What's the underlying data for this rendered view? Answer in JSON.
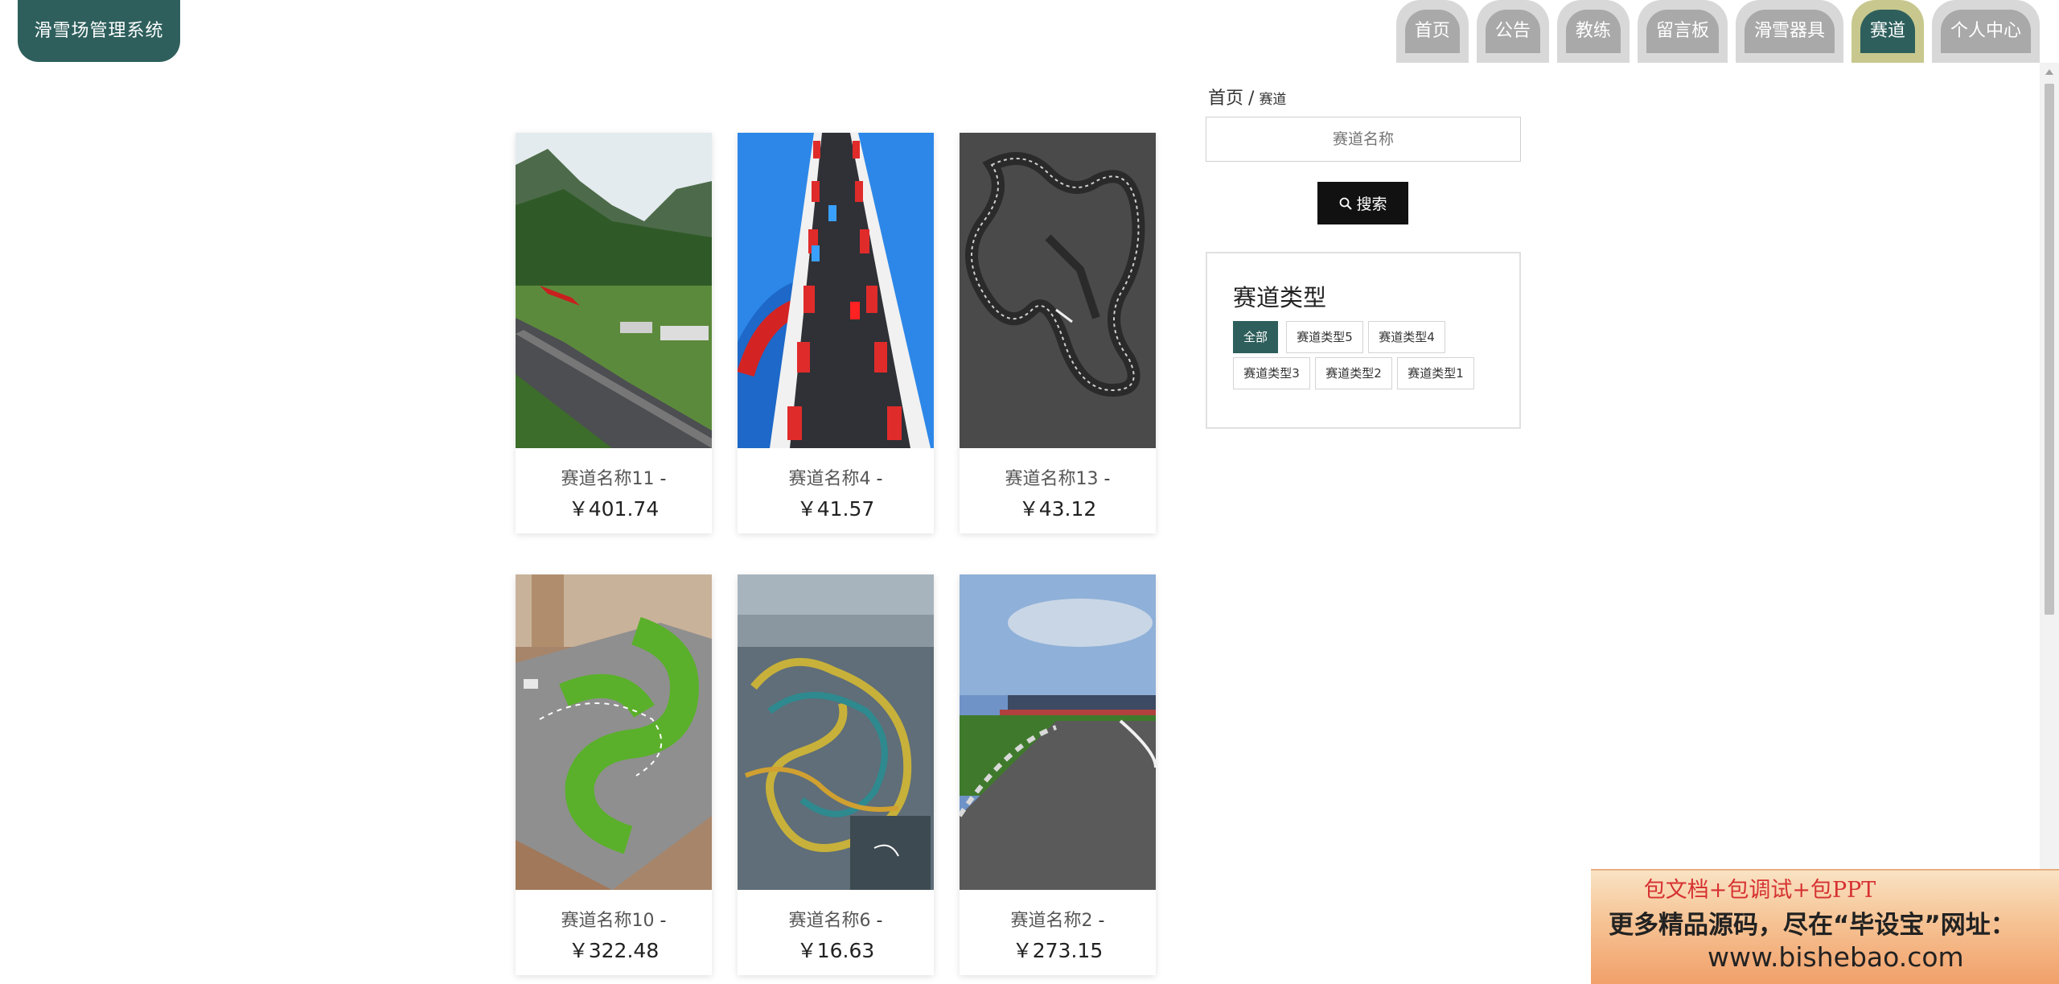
{
  "app": {
    "logo_text": "滑雪场管理系统"
  },
  "nav": {
    "items": [
      {
        "label": "首页",
        "active": false
      },
      {
        "label": "公告",
        "active": false
      },
      {
        "label": "教练",
        "active": false
      },
      {
        "label": "留言板",
        "active": false
      },
      {
        "label": "滑雪器具",
        "active": false
      },
      {
        "label": "赛道",
        "active": true
      },
      {
        "label": "个人中心",
        "active": false
      }
    ]
  },
  "breadcrumb": {
    "home": "首页",
    "separator": "/",
    "current": "赛道"
  },
  "search": {
    "placeholder": "赛道名称",
    "button_label": "搜索",
    "button_icon": "search-icon"
  },
  "track_types": {
    "title": "赛道类型",
    "options": [
      {
        "label": "全部",
        "active": true
      },
      {
        "label": "赛道类型5",
        "active": false
      },
      {
        "label": "赛道类型4",
        "active": false
      },
      {
        "label": "赛道类型3",
        "active": false
      },
      {
        "label": "赛道类型2",
        "active": false
      },
      {
        "label": "赛道类型1",
        "active": false
      }
    ]
  },
  "products": [
    {
      "name": "赛道名称11",
      "dash": "-",
      "price": "￥401.74",
      "image": "mountain-race-circuit"
    },
    {
      "name": "赛道名称4",
      "dash": "-",
      "price": "￥41.57",
      "image": "toy-race-ramp"
    },
    {
      "name": "赛道名称13",
      "dash": "-",
      "price": "￥43.12",
      "image": "circuit-map"
    },
    {
      "name": "赛道名称10",
      "dash": "-",
      "price": "￥322.48",
      "image": "rc-indoor-track"
    },
    {
      "name": "赛道名称6",
      "dash": "-",
      "price": "￥16.63",
      "image": "aerial-city-circuit"
    },
    {
      "name": "赛道名称2",
      "dash": "-",
      "price": "￥273.15",
      "image": "racetrack-curve"
    }
  ],
  "ad": {
    "line1": "包文档+包调试+包PPT",
    "line2": "更多精品源码，尽在“毕设宝”网址：",
    "line3": "www.bishebao.com"
  },
  "colors": {
    "primary": "#2e5f5c",
    "nav_active_ring": "#c8c88e",
    "nav_pill": "#a9a9a9",
    "search_button": "#111111",
    "ad_text_red": "#d63131"
  }
}
